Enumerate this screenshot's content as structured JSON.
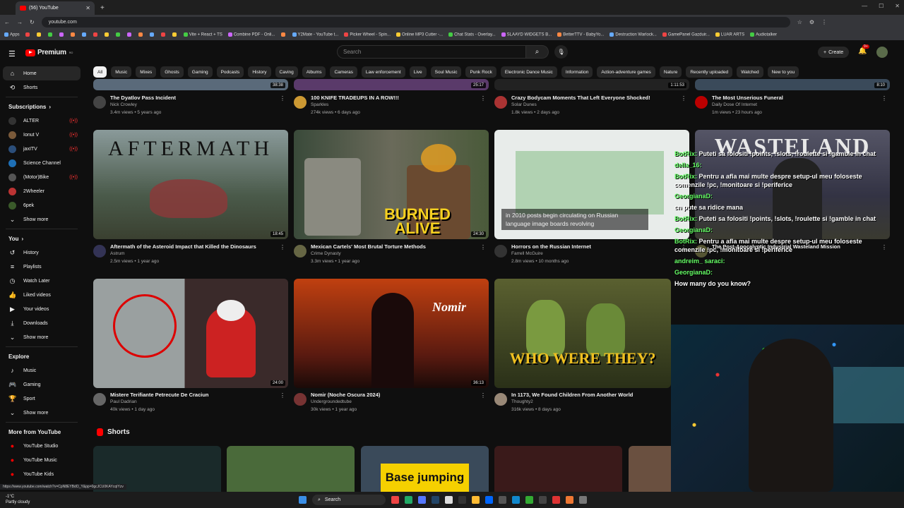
{
  "browser": {
    "tab_title": "(56) YouTube",
    "url": "youtube.com",
    "status_url": "https://www.youtube.com/watch?v=CpN8EYBdO_Y&pp=0gcJCU0KAYcqIYzv",
    "bookmarks": [
      "Apps",
      "",
      "",
      "",
      "",
      "",
      "",
      "",
      "",
      "",
      "",
      "",
      "",
      "",
      "",
      "Vite + React + TS",
      "Combine PDF - Onli...",
      "",
      "Y2Mate - YouTube t...",
      "Picker Wheel - Spin...",
      "Online MP3 Cutter -...",
      "Chat Stats - Overlay...",
      "SLAAYD WIDGETS B...",
      "BetterTTV - BabyYo...",
      "Destruction Warlock...",
      "GamePanel Gazduir...",
      "LUAR ARTS",
      "Audiotalker"
    ]
  },
  "masthead": {
    "logo_text": "Premium",
    "logo_sup": "RO",
    "search_placeholder": "Search",
    "create_label": "Create",
    "notif_count": "9+"
  },
  "sidebar": {
    "home": "Home",
    "shorts": "Shorts",
    "subscriptions_head": "Subscriptions",
    "subs": [
      {
        "name": "ALTER",
        "color": "#333",
        "live": true
      },
      {
        "name": "Ionut V",
        "color": "#7a5a3a",
        "live": true
      },
      {
        "name": "jaxITV",
        "color": "#2b4e7a",
        "live": true
      },
      {
        "name": "Science Channel",
        "color": "#1e6fb5",
        "live": false
      },
      {
        "name": "(Motor)Bike",
        "color": "#555",
        "live": true
      },
      {
        "name": "2Wheeler",
        "color": "#b33",
        "live": false
      },
      {
        "name": "6pek",
        "color": "#3a5a2a",
        "live": false
      }
    ],
    "show_more_1": "Show more",
    "you_head": "You",
    "you_items": [
      "History",
      "Playlists",
      "Watch Later",
      "Liked videos",
      "Your videos",
      "Downloads"
    ],
    "show_more_2": "Show more",
    "explore_head": "Explore",
    "explore_items": [
      "Music",
      "Gaming",
      "Sport"
    ],
    "show_more_3": "Show more",
    "more_head": "More from YouTube",
    "more_items": [
      "YouTube Studio",
      "YouTube Music",
      "YouTube Kids"
    ]
  },
  "chips": [
    "All",
    "Music",
    "Mixes",
    "Ghosts",
    "Gaming",
    "Podcasts",
    "History",
    "Caving",
    "Albums",
    "Cameras",
    "Law enforcement",
    "Live",
    "Soul Music",
    "Punk Rock",
    "Electronic Dance Music",
    "Information",
    "Action-adventure games",
    "Nature",
    "Recently uploaded",
    "Watched",
    "New to you"
  ],
  "row0": [
    {
      "title": "The Dyatlov Pass Incident",
      "channel": "Nick Crowley",
      "stats": "3.4m views • 5 years ago",
      "duration": "38:38"
    },
    {
      "title": "100 KNIFE TRADEUPS IN A ROW!!!",
      "channel": "Sparkles",
      "stats": "274k views • 6 days ago",
      "duration": "25:17"
    },
    {
      "title": "Crazy Bodycam Moments That Left Everyone Shocked!",
      "channel": "Solar Dunes",
      "stats": "1.8k views • 2 days ago",
      "duration": "1:11:53"
    },
    {
      "title": "The Most Unserious Funeral",
      "channel": "Daily Dose Of Internet",
      "stats": "1m views • 23 hours ago",
      "duration": "8:10"
    }
  ],
  "row1": [
    {
      "title": "Aftermath of the Asteroid Impact that Killed the Dinosaurs",
      "channel": "Astrum",
      "stats": "2.5m views • 1 year ago",
      "duration": "18:45",
      "thumb_text": "AFTERMATH"
    },
    {
      "title": "Mexican Cartels' Most Brutal Torture Methods",
      "channel": "Crime Dynasty",
      "stats": "3.3m views • 1 year ago",
      "duration": "24:30",
      "thumb_text": "BURNED ALIVE"
    },
    {
      "title": "Horrors on the Russian Internet",
      "channel": "Farrell McGuire",
      "stats": "2.8m views • 10 months ago",
      "duration": "",
      "thumb_text": "in 2010 posts begin circulating on Russian language image boards revolving"
    },
    {
      "title": "The Post-Apocalyptic Industrial Wasteland Mission",
      "channel": "",
      "stats": "",
      "duration": "",
      "thumb_text": "WASTELAND"
    }
  ],
  "row2": [
    {
      "title": "Mistere Terifiante Petrecute De Craciun",
      "channel": "Paul Dadrian",
      "stats": "40k views • 1 day ago",
      "duration": "24:00"
    },
    {
      "title": "Nomir (Noche Oscura 2024)",
      "channel": "Undergroundedtube",
      "stats": "30k views • 1 year ago",
      "duration": "36:13",
      "thumb_text": "Nomir"
    },
    {
      "title": "In 1173, We Found Children From Another World",
      "channel": "Thoughty2",
      "stats": "316k views • 8 days ago",
      "duration": "",
      "thumb_text": "WHO WERE THEY?"
    }
  ],
  "shorts_head": "Shorts",
  "short_thumb_text": "Base jumping",
  "chat": [
    {
      "user": "BotRix:",
      "msg": "Puteti sa folositi !points, !slots, !roulette si !gamble in chat"
    },
    {
      "user": "della_16:",
      "msg": ""
    },
    {
      "user": "BotRix:",
      "msg": "Pentru a afla mai multe despre setup-ul meu foloseste comenzile !pc, !monitoare si !periferice"
    },
    {
      "user": "GeorgianaD:",
      "msg": ""
    },
    {
      "user": "",
      "msg": "cn pute sa ridice mana"
    },
    {
      "user": "BotRix:",
      "msg": "Puteti sa folositi !points, !slots, !roulette si !gamble in chat"
    },
    {
      "user": "GeorgianaD:",
      "msg": ""
    },
    {
      "user": "BotRix:",
      "msg": "Pentru a afla mai multe despre setup-ul meu foloseste comenzile !pc, !monitoare si !periferice"
    },
    {
      "user": "andreim_ saraci:",
      "msg": ""
    },
    {
      "user": "GeorgianaD:",
      "msg": ""
    },
    {
      "user": "",
      "msg": "How many do you know?"
    }
  ],
  "taskbar": {
    "search": "Search",
    "weather_temp": "-1°C",
    "weather_desc": "Partly cloudy"
  }
}
